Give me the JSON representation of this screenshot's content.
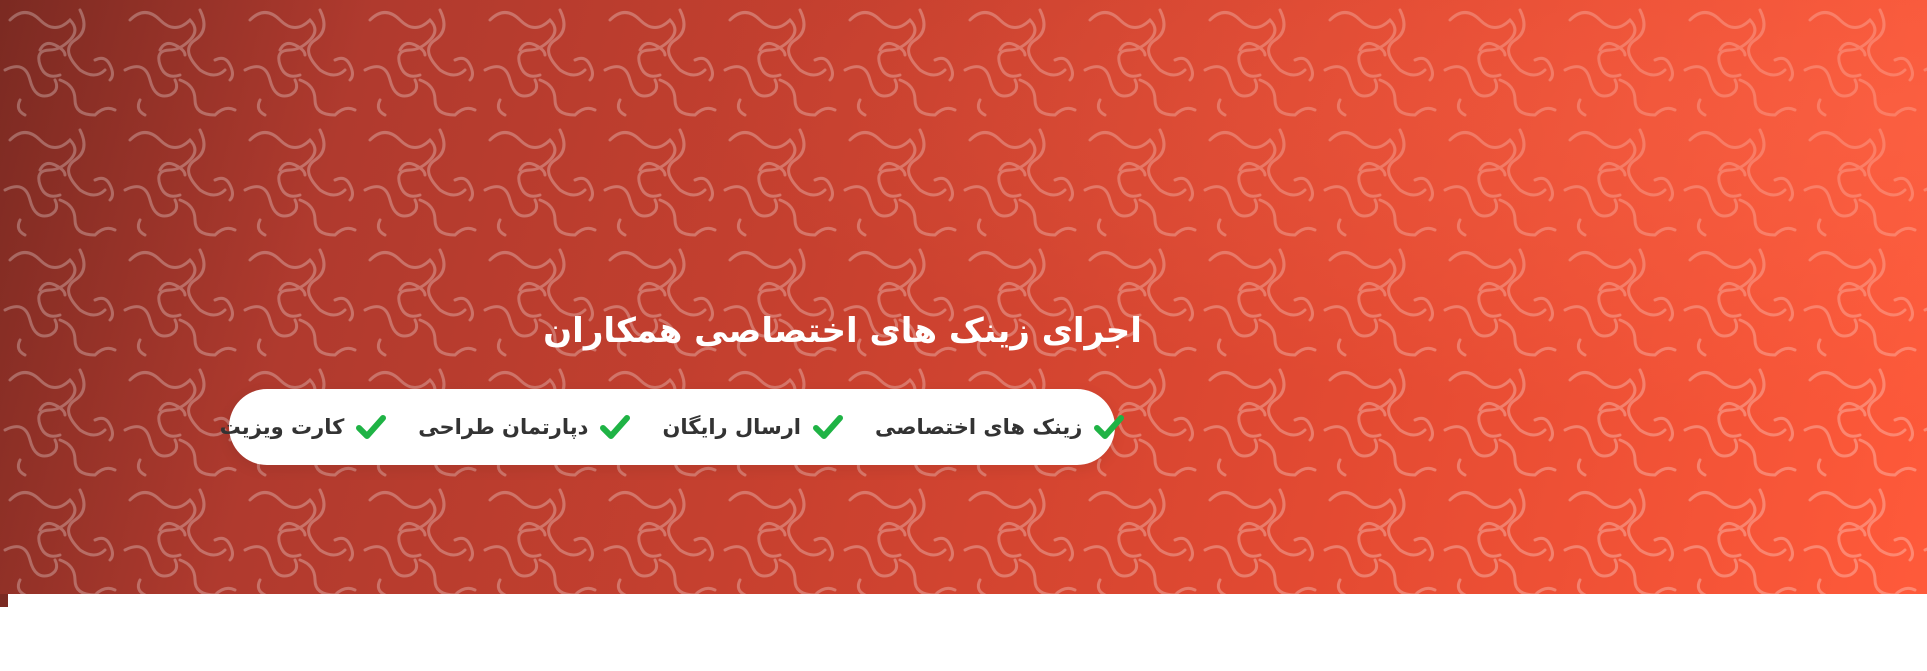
{
  "hero": {
    "title": "اجرای زینک های اختصاصی همکاران",
    "features": [
      {
        "label": "کارت ویزیت",
        "icon": "check-icon"
      },
      {
        "label": "دپارتمان طراحی",
        "icon": "check-icon"
      },
      {
        "label": "ارسال رایگان",
        "icon": "check-icon"
      },
      {
        "label": "زینک های اختصاصی",
        "icon": "check-icon"
      }
    ]
  },
  "colors": {
    "check": "#1fb345",
    "title_text": "#ffffff",
    "feature_text": "#333333",
    "gradient_start": "#7b2a22",
    "gradient_end": "#ff5a3a"
  }
}
